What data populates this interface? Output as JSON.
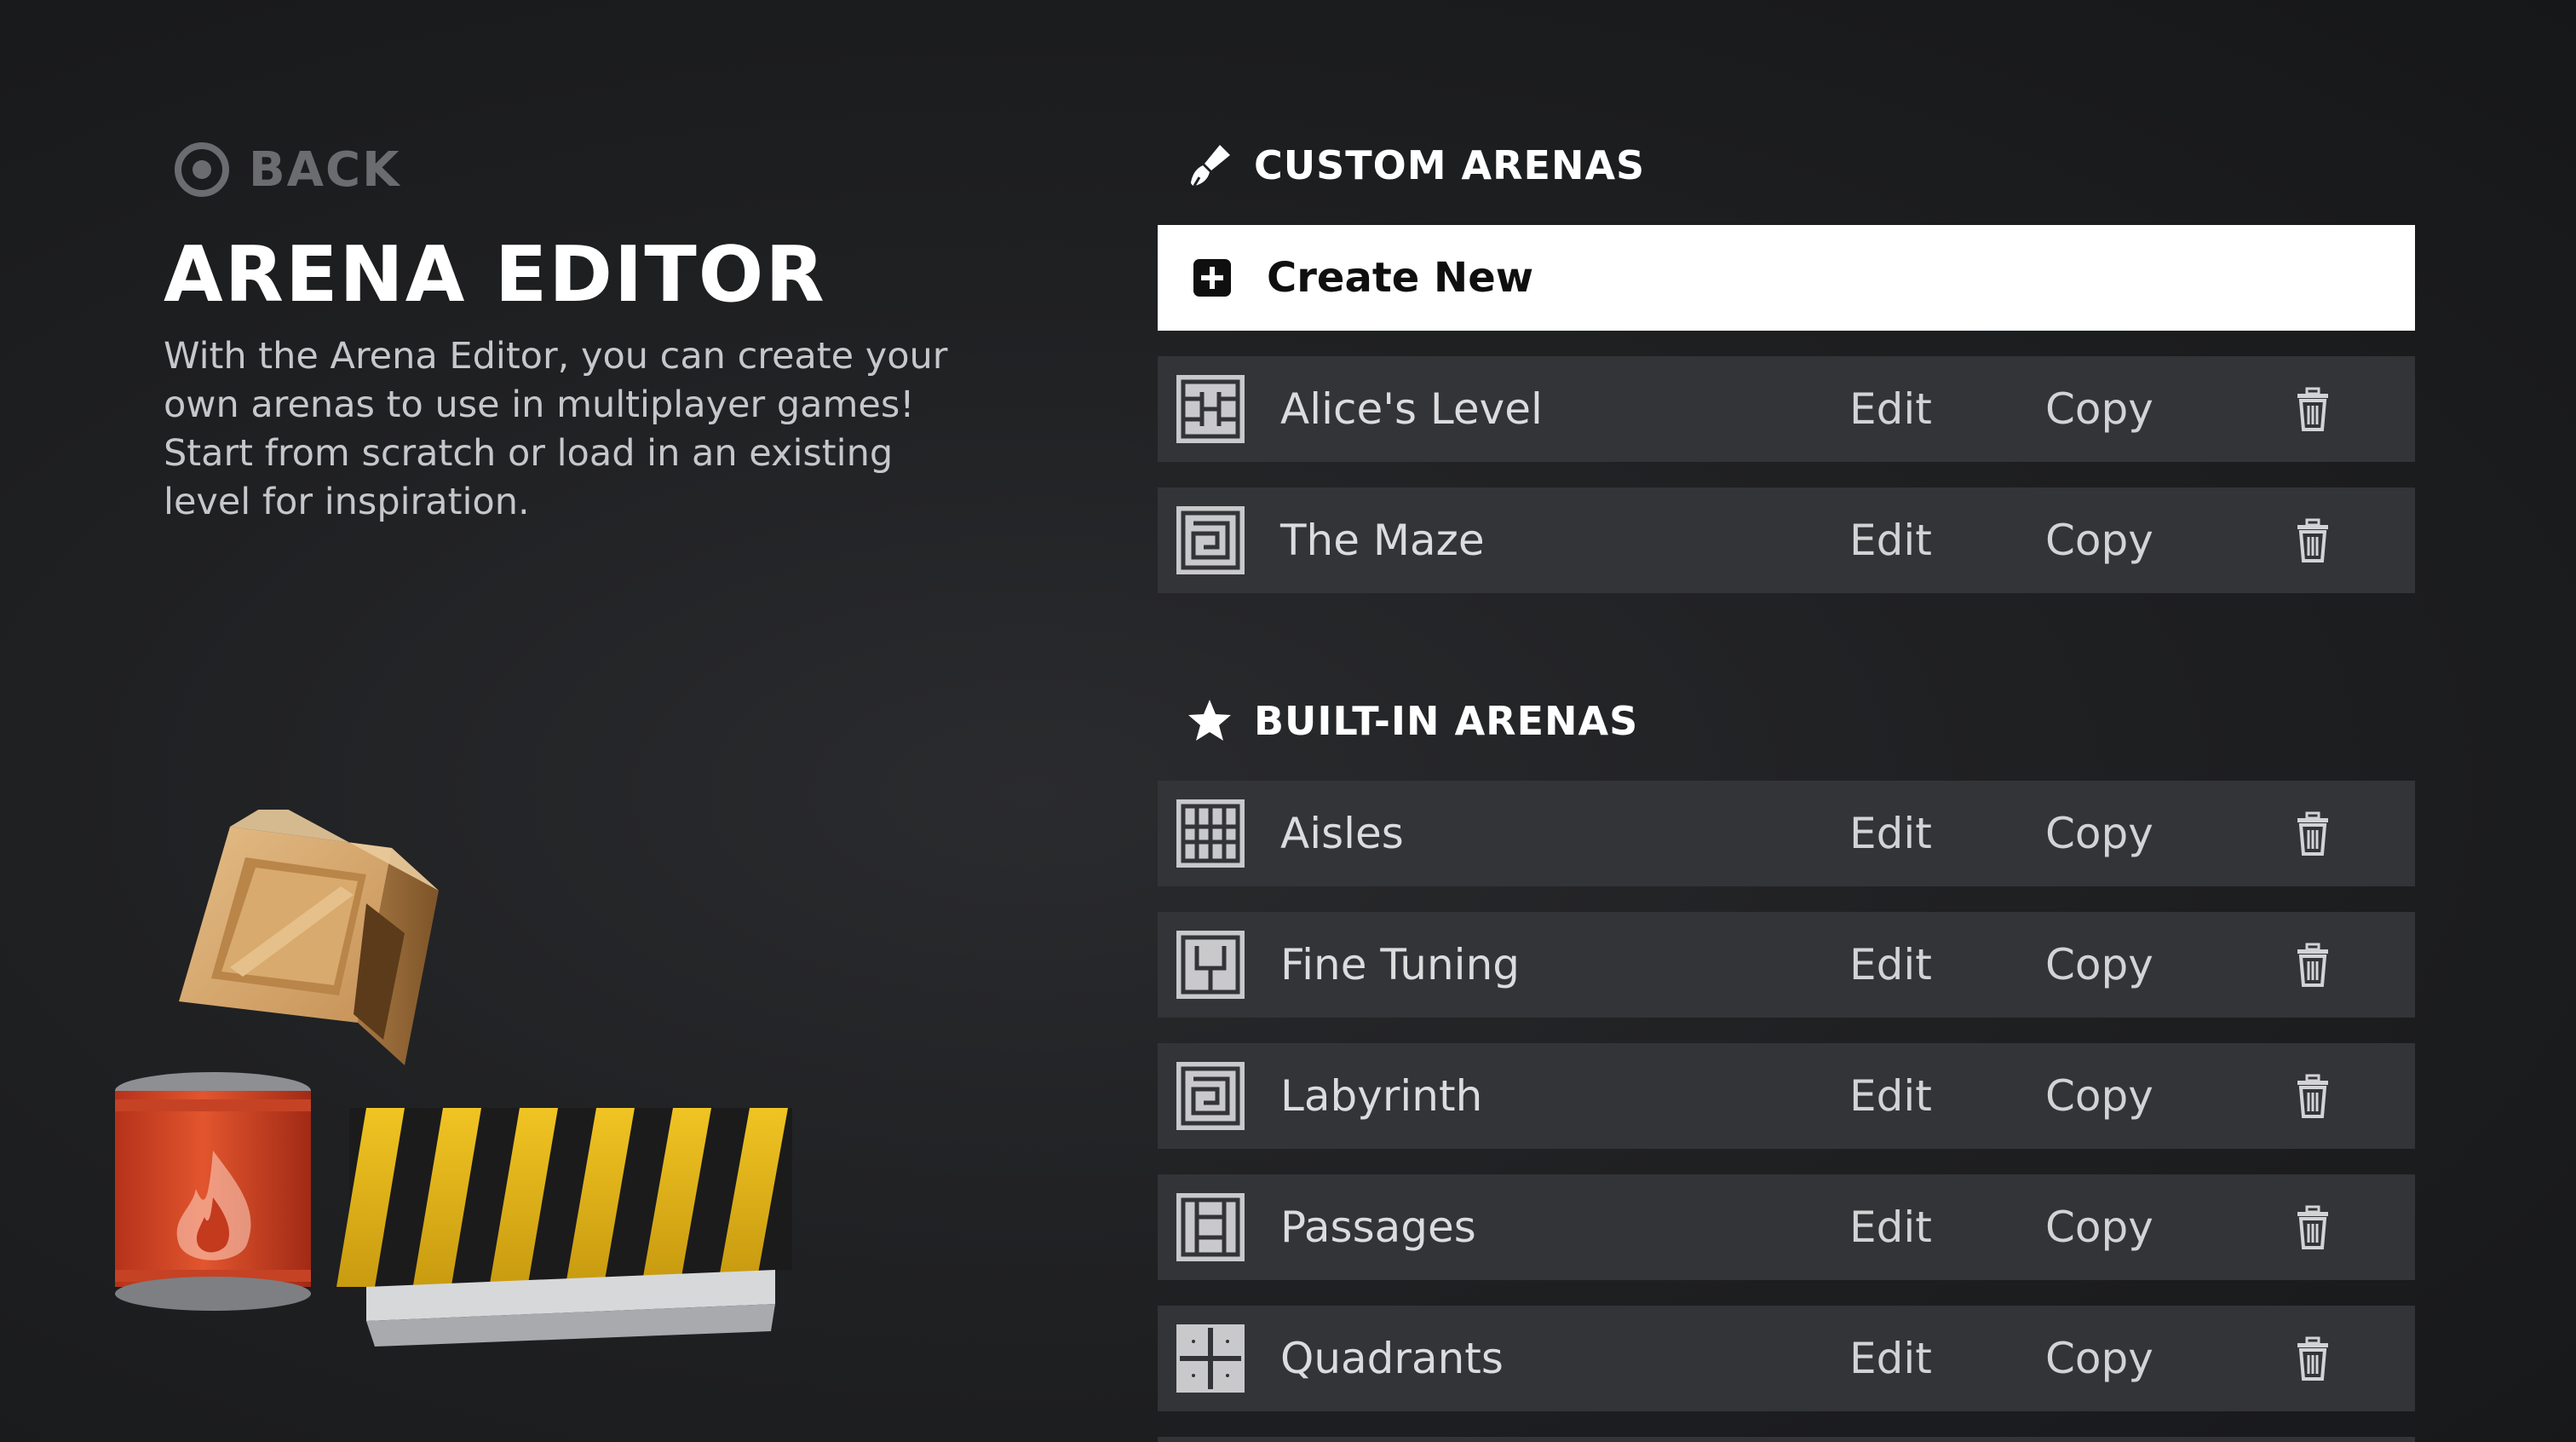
{
  "colors": {
    "background": "#1f2022",
    "row_background": "#333437",
    "create_background": "#ffffff",
    "title_text": "#ffffff",
    "back_text": "#6b6c70",
    "body_text": "#c6c7ca"
  },
  "header": {
    "back_label": "BACK",
    "back_icon": "circle-button-icon",
    "title": "ARENA EDITOR",
    "description": "With the Arena Editor, you can create your own arenas to use in multiplayer games! Start from scratch or load in an existing level for inspiration."
  },
  "illustration": {
    "items": [
      "wooden-crate",
      "red-fire-barrel",
      "yellow-black-hazard-barrier"
    ]
  },
  "custom_arenas": {
    "title": "CUSTOM ARENAS",
    "icon": "paintbrush-icon",
    "create_new": {
      "label": "Create New",
      "icon": "plus-square-icon"
    },
    "items": [
      {
        "name": "Alice's Level",
        "icon": "custom-grid-layout-icon",
        "edit_label": "Edit",
        "copy_label": "Copy",
        "delete_icon": "trash-icon"
      },
      {
        "name": "The Maze",
        "icon": "maze-layout-icon",
        "edit_label": "Edit",
        "copy_label": "Copy",
        "delete_icon": "trash-icon"
      }
    ]
  },
  "built_in_arenas": {
    "title": "BUILT-IN ARENAS",
    "icon": "star-icon",
    "items": [
      {
        "name": "Aisles",
        "icon": "aisles-layout-icon",
        "edit_label": "Edit",
        "copy_label": "Copy",
        "delete_icon": "trash-icon"
      },
      {
        "name": "Fine Tuning",
        "icon": "fine-tuning-layout-icon",
        "edit_label": "Edit",
        "copy_label": "Copy",
        "delete_icon": "trash-icon"
      },
      {
        "name": "Labyrinth",
        "icon": "labyrinth-layout-icon",
        "edit_label": "Edit",
        "copy_label": "Copy",
        "delete_icon": "trash-icon"
      },
      {
        "name": "Passages",
        "icon": "passages-layout-icon",
        "edit_label": "Edit",
        "copy_label": "Copy",
        "delete_icon": "trash-icon"
      },
      {
        "name": "Quadrants",
        "icon": "quadrants-layout-icon",
        "edit_label": "Edit",
        "copy_label": "Copy",
        "delete_icon": "trash-icon"
      }
    ]
  }
}
